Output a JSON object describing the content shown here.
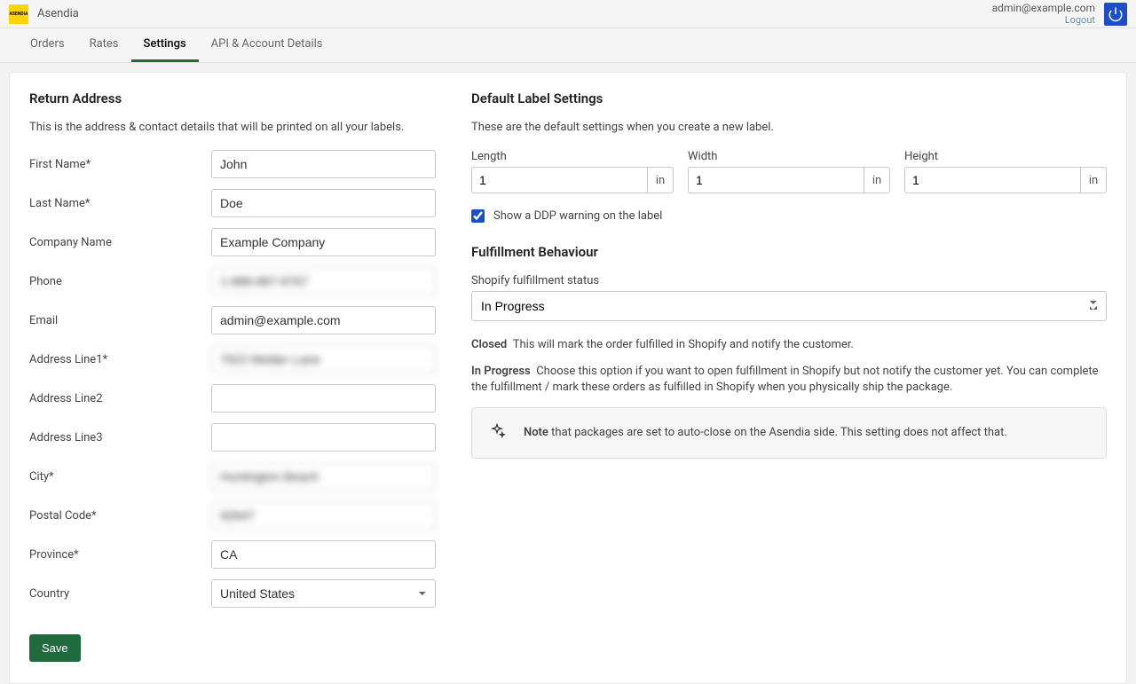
{
  "header": {
    "brand": "Asendia",
    "user_email": "admin@example.com",
    "logout": "Logout"
  },
  "tabs": [
    "Orders",
    "Rates",
    "Settings",
    "API & Account Details"
  ],
  "return_address": {
    "title": "Return Address",
    "desc": "This is the address & contact details that will be printed on all your labels.",
    "fields": {
      "first_name": {
        "label": "First Name*",
        "value": "John"
      },
      "last_name": {
        "label": "Last Name*",
        "value": "Doe"
      },
      "company": {
        "label": "Company Name",
        "value": "Example Company"
      },
      "phone": {
        "label": "Phone",
        "value": "1-888-887-6767"
      },
      "email": {
        "label": "Email",
        "value": "admin@example.com"
      },
      "address1": {
        "label": "Address Line1*",
        "value": "7922 Melder Lane"
      },
      "address2": {
        "label": "Address Line2",
        "value": ""
      },
      "address3": {
        "label": "Address Line3",
        "value": ""
      },
      "city": {
        "label": "City*",
        "value": "Huntington Beach"
      },
      "postal": {
        "label": "Postal Code*",
        "value": "92647"
      },
      "province": {
        "label": "Province*",
        "value": "CA"
      },
      "country": {
        "label": "Country",
        "value": "United States"
      }
    }
  },
  "label_settings": {
    "title": "Default Label Settings",
    "desc": "These are the default settings when you create a new label.",
    "dims": {
      "length": {
        "label": "Length",
        "value": "1",
        "unit": "in"
      },
      "width": {
        "label": "Width",
        "value": "1",
        "unit": "in"
      },
      "height": {
        "label": "Height",
        "value": "1",
        "unit": "in"
      }
    },
    "ddp_label": "Show a DDP warning on the label"
  },
  "fulfillment": {
    "title": "Fulfillment Behaviour",
    "status_label": "Shopify fulfillment status",
    "status_value": "In Progress",
    "closed": {
      "label": "Closed",
      "text": "This will mark the order fulfilled in Shopify and notify the customer."
    },
    "in_progress": {
      "label": "In Progress",
      "text": "Choose this option if you want to open fulfillment in Shopify but not notify the customer yet. You can complete the fulfillment / mark these orders as fulfilled in Shopify when you physically ship the package."
    },
    "note": {
      "label": "Note",
      "text": "that packages are set to auto-close on the Asendia side. This setting does not affect that."
    }
  },
  "save_label": "Save"
}
